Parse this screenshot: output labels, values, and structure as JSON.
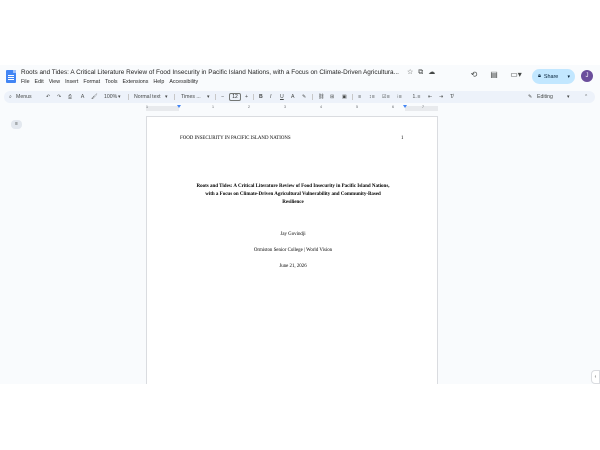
{
  "document": {
    "title": "Roots and Tides: A Critical Literature Review of Food Insecurity in Pacific Island Nations, with a Focus on Climate-Driven Agricultura...",
    "menu": [
      "File",
      "Edit",
      "View",
      "Insert",
      "Format",
      "Tools",
      "Extensions",
      "Help",
      "Accessibility"
    ]
  },
  "title_icons": [
    "star-icon",
    "move-to-folder-icon",
    "cloud-status-icon"
  ],
  "header_right": {
    "icons": [
      "history-icon",
      "comments-icon",
      "meet-icon"
    ],
    "share_label": "Share",
    "avatar_letter": "J"
  },
  "toolbar": {
    "menus_label": "Menus",
    "zoom": "100%",
    "style": "Normal text",
    "font": "Times ...",
    "font_size": "12",
    "editing_label": "Editing"
  },
  "ruler": {
    "numbers": [
      "1",
      "1",
      "2",
      "3",
      "4",
      "5",
      "6",
      "7"
    ]
  },
  "page": {
    "running_head": "FOOD INSECURITY IN PACIFIC ISLAND NATIONS",
    "page_number": "1",
    "title_lines": [
      "Roots and Tides: A Critical Literature Review of Food Insecurity in Pacific Island Nations,",
      "with a Focus on Climate-Driven Agricultural Vulnerability and Community-Based",
      "Resilience"
    ],
    "author": "Jay Govindji",
    "affiliation": "Ormiston Senior College | World Vision",
    "date": "June 21, 2026"
  }
}
